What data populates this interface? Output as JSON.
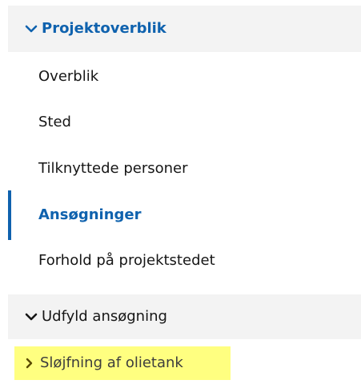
{
  "nav": {
    "sections": [
      {
        "label": "Projektoverblik",
        "expanded": true,
        "icon": "chevron-down-icon",
        "color": "#0f62ae",
        "items": [
          {
            "label": "Overblik",
            "active": false
          },
          {
            "label": "Sted",
            "active": false
          },
          {
            "label": "Tilknyttede personer",
            "active": false
          },
          {
            "label": "Ansøgninger",
            "active": true
          },
          {
            "label": "Forhold på projektstedet",
            "active": false
          }
        ]
      },
      {
        "label": "Udfyld ansøgning",
        "expanded": true,
        "icon": "chevron-down-icon",
        "items": [
          {
            "label": "Sløjfning af olietank",
            "icon": "chevron-right-icon",
            "highlighted": true
          }
        ]
      }
    ],
    "accent_color": "#0f62ae",
    "highlight_color": "#ffff80"
  }
}
